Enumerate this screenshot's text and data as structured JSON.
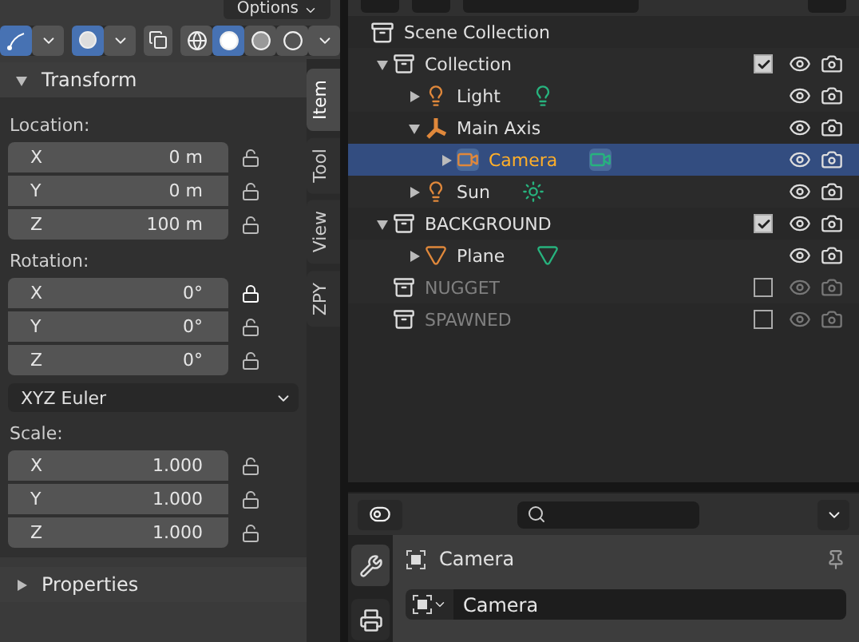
{
  "viewport_header": {
    "options_button": "Options",
    "shading": [
      {
        "kind": "wireframe",
        "selected": false
      },
      {
        "kind": "solid",
        "selected": true
      },
      {
        "kind": "material",
        "selected": false
      },
      {
        "kind": "rendered",
        "selected": false
      }
    ]
  },
  "transform_panel": {
    "title": "Transform",
    "expanded": true,
    "sections": [
      {
        "kind": "vector",
        "label": "Location:",
        "fields": [
          {
            "axis": "X",
            "value": "0 m",
            "locked": false
          },
          {
            "axis": "Y",
            "value": "0 m",
            "locked": false
          },
          {
            "axis": "Z",
            "value": "100 m",
            "locked": false
          }
        ]
      },
      {
        "kind": "vector",
        "label": "Rotation:",
        "fields": [
          {
            "axis": "X",
            "value": "0°",
            "locked": true
          },
          {
            "axis": "Y",
            "value": "0°",
            "locked": false
          },
          {
            "axis": "Z",
            "value": "0°",
            "locked": false
          }
        ]
      },
      {
        "kind": "dropdown",
        "value": "XYZ Euler"
      },
      {
        "kind": "vector",
        "label": "Scale:",
        "fields": [
          {
            "axis": "X",
            "value": "1.000",
            "locked": false
          },
          {
            "axis": "Y",
            "value": "1.000",
            "locked": false
          },
          {
            "axis": "Z",
            "value": "1.000",
            "locked": false
          }
        ]
      }
    ]
  },
  "properties_panel": {
    "title": "Properties",
    "expanded": false
  },
  "sidebar_tabs": [
    {
      "label": "Item",
      "selected": true
    },
    {
      "label": "Tool",
      "selected": false
    },
    {
      "label": "View",
      "selected": false
    },
    {
      "label": "ZPY",
      "selected": false
    }
  ],
  "outliner": {
    "root": "Scene Collection",
    "items": [
      {
        "name": "Collection",
        "kind": "collection",
        "expanded": true,
        "checked": true,
        "selected": false,
        "children": [
          {
            "name": "Light",
            "kind": "light",
            "expanded": false,
            "selected": false
          },
          {
            "name": "Main Axis",
            "kind": "empty",
            "expanded": true,
            "selected": false,
            "children": [
              {
                "name": "Camera",
                "kind": "camera",
                "expanded": false,
                "selected": true
              }
            ]
          },
          {
            "name": "Sun",
            "kind": "sun",
            "expanded": false,
            "selected": false
          }
        ]
      },
      {
        "name": "BACKGROUND",
        "kind": "collection",
        "expanded": true,
        "checked": true,
        "selected": false,
        "children": [
          {
            "name": "Plane",
            "kind": "mesh",
            "expanded": false,
            "selected": false
          }
        ]
      },
      {
        "name": "NUGGET",
        "kind": "collection",
        "checked": false,
        "selected": false
      },
      {
        "name": "SPAWNED",
        "kind": "collection",
        "checked": false,
        "selected": false
      }
    ]
  },
  "properties_editor": {
    "tabs": [
      {
        "kind": "tool",
        "selected": true
      },
      {
        "kind": "render",
        "selected": false
      }
    ],
    "object_name": "Camera",
    "datablock": "Camera"
  }
}
